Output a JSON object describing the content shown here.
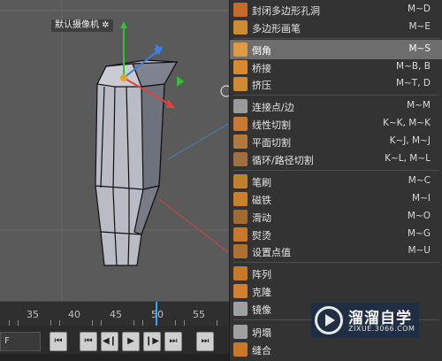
{
  "viewport": {
    "camera_label": "默认摄像机 ✲"
  },
  "timeline": {
    "ticks": [
      "35",
      "40",
      "45",
      "50",
      "55"
    ],
    "frame_value": "F"
  },
  "transport": {
    "buttons": [
      "⏮",
      "⏮",
      "◀❙",
      "▶",
      "❙▶",
      "⏭",
      "⏭"
    ]
  },
  "menu": {
    "items": [
      {
        "label": "封闭多边形孔洞",
        "shortcut": "M~D",
        "icon": "close-hole-icon",
        "color": "#c86a2a"
      },
      {
        "label": "多边形画笔",
        "shortcut": "M~E",
        "icon": "polygon-pen-icon",
        "color": "#d08a30"
      },
      {
        "label": "倒角",
        "shortcut": "M~S",
        "icon": "bevel-icon",
        "color": "#e09a40",
        "highlighted": true
      },
      {
        "label": "桥接",
        "shortcut": "M~B, B",
        "icon": "bridge-icon",
        "color": "#d88a30"
      },
      {
        "label": "挤压",
        "shortcut": "M~T, D",
        "icon": "extrude-icon",
        "color": "#d08a30"
      },
      {
        "label": "连接点/边",
        "shortcut": "M~M",
        "icon": "connect-icon",
        "color": "#9a9a9a"
      },
      {
        "label": "线性切割",
        "shortcut": "K~K, M~K",
        "icon": "knife-icon",
        "color": "#c87a30"
      },
      {
        "label": "平面切割",
        "shortcut": "K~J, M~J",
        "icon": "plane-cut-icon",
        "color": "#b07a40"
      },
      {
        "label": "循环/路径切割",
        "shortcut": "K~L, M~L",
        "icon": "loop-cut-icon",
        "color": "#a07040"
      },
      {
        "label": "笔刷",
        "shortcut": "M~C",
        "icon": "brush-icon",
        "color": "#c08030"
      },
      {
        "label": "磁铁",
        "shortcut": "M~I",
        "icon": "magnet-icon",
        "color": "#c88030"
      },
      {
        "label": "滑动",
        "shortcut": "M~O",
        "icon": "slide-icon",
        "color": "#a06a30"
      },
      {
        "label": "熨烫",
        "shortcut": "M~G",
        "icon": "iron-icon",
        "color": "#c8782a"
      },
      {
        "label": "设置点值",
        "shortcut": "M~U",
        "icon": "xyz-icon",
        "color": "#b07030"
      },
      {
        "label": "阵列",
        "shortcut": "",
        "icon": "array-icon",
        "color": "#c8782a"
      },
      {
        "label": "克隆",
        "shortcut": "",
        "icon": "clone-icon",
        "color": "#d08030"
      },
      {
        "label": "镜像",
        "shortcut": "",
        "icon": "mirror-icon",
        "color": "#a0a0a0"
      },
      {
        "label": "坍塌",
        "shortcut": "",
        "icon": "collapse-icon",
        "color": "#a0a0a0"
      },
      {
        "label": "缝合",
        "shortcut": "",
        "icon": "stitch-icon",
        "color": "#c8782a"
      }
    ]
  },
  "watermark": {
    "title": "溜溜自学",
    "subtitle": "ZIXUE.3066.COM"
  }
}
